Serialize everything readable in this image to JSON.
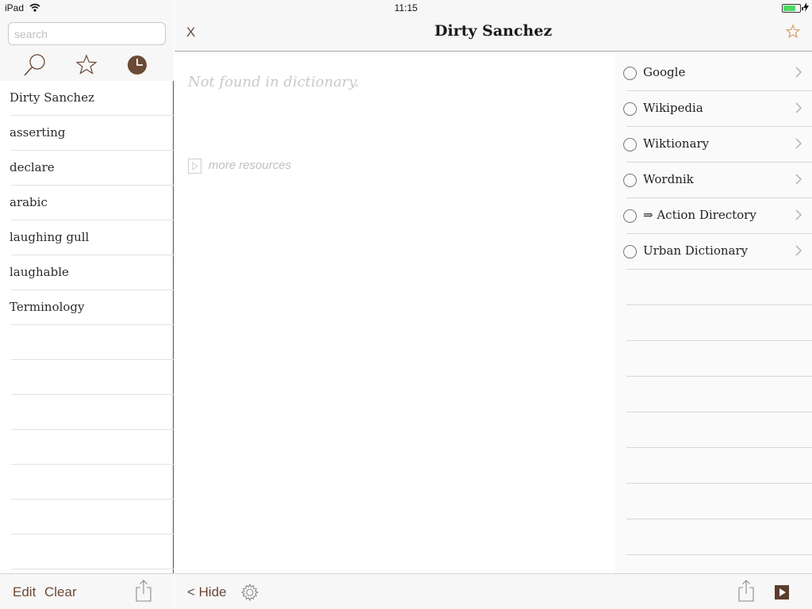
{
  "status_bar": {
    "device": "iPad",
    "time": "11:15",
    "battery_level": 0.75
  },
  "sidebar": {
    "search_placeholder": "search",
    "tabs": [
      {
        "name": "search",
        "icon": "magnifier-icon",
        "selected": false
      },
      {
        "name": "favorites",
        "icon": "star-icon",
        "selected": false
      },
      {
        "name": "history",
        "icon": "clock-icon",
        "selected": true
      }
    ],
    "history": [
      "Dirty Sanchez",
      "asserting",
      "declare",
      "arabic",
      "laughing gull",
      "laughable",
      "Terminology"
    ],
    "edit_label": "Edit",
    "clear_label": "Clear"
  },
  "nav": {
    "close_label": "X",
    "title": "Dirty Sanchez"
  },
  "content": {
    "not_found": "Not found in dictionary.",
    "more_resources": "more resources"
  },
  "resources": [
    {
      "label": "Google"
    },
    {
      "label": "Wikipedia"
    },
    {
      "label": "Wiktionary"
    },
    {
      "label": "Wordnik"
    },
    {
      "label": "⇒ Action Directory"
    },
    {
      "label": "Urban Dictionary"
    }
  ],
  "toolbar": {
    "hide_label": "< Hide"
  },
  "colors": {
    "accent": "#6b4a36",
    "star": "#d9a066",
    "battery": "#4cd964",
    "divider": "#e2e2e2"
  }
}
